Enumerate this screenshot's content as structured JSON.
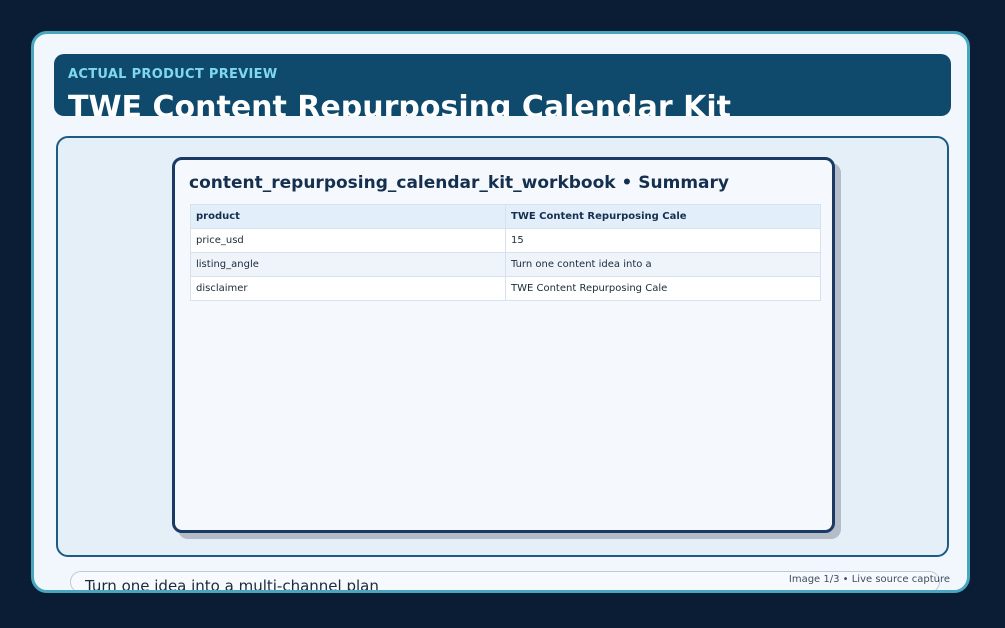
{
  "banner": {
    "eyebrow": "ACTUAL PRODUCT PREVIEW",
    "title": "TWE Content Repurposing Calendar Kit"
  },
  "sheet": {
    "title": "content_repurposing_calendar_kit_workbook • Summary",
    "table": {
      "header": [
        "product",
        "TWE Content Repurposing Cale"
      ],
      "rows": [
        [
          "price_usd",
          "15"
        ],
        [
          "listing_angle",
          "Turn one content idea into a"
        ],
        [
          "disclaimer",
          "TWE Content Repurposing Cale"
        ]
      ]
    }
  },
  "caption": {
    "text": "Turn one idea into a multi-channel plan"
  },
  "image_meta": "Image 1/3 • Live source capture"
}
